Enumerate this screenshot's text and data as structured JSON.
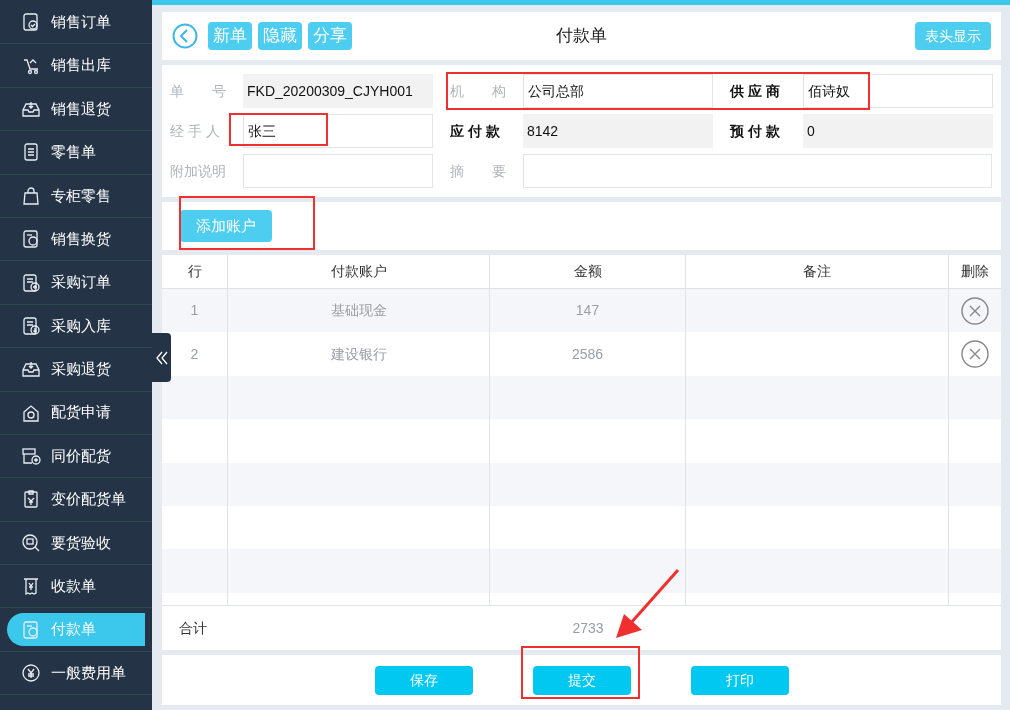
{
  "sidebar": {
    "items": [
      {
        "label": "销售订单",
        "selected": false
      },
      {
        "label": "销售出库",
        "selected": false
      },
      {
        "label": "销售退货",
        "selected": false
      },
      {
        "label": "零售单",
        "selected": false
      },
      {
        "label": "专柜零售",
        "selected": false
      },
      {
        "label": "销售换货",
        "selected": false
      },
      {
        "label": "采购订单",
        "selected": false
      },
      {
        "label": "采购入库",
        "selected": false
      },
      {
        "label": "采购退货",
        "selected": false
      },
      {
        "label": "配货申请",
        "selected": false
      },
      {
        "label": "同价配货",
        "selected": false
      },
      {
        "label": "变价配货单",
        "selected": false
      },
      {
        "label": "要货验收",
        "selected": false
      },
      {
        "label": "收款单",
        "selected": false
      },
      {
        "label": "付款单",
        "selected": true
      },
      {
        "label": "一般费用单",
        "selected": false
      }
    ]
  },
  "toolbar": {
    "buttons": [
      "新单",
      "隐藏",
      "分享"
    ],
    "title": "付款单",
    "right_button": "表头显示"
  },
  "form": {
    "rows": [
      [
        {
          "label": "单　　号",
          "value": "FKD_20200309_CJYH001",
          "emphasis": false,
          "readonly": true
        },
        {
          "label": "机　　构",
          "value": "公司总部",
          "emphasis": false,
          "readonly": false
        },
        {
          "label": "供 应 商",
          "value": "佰诗奴",
          "emphasis": true,
          "readonly": false
        }
      ],
      [
        {
          "label": "经 手 人",
          "value": "张三",
          "emphasis": false,
          "readonly": false
        },
        {
          "label": "应 付 款",
          "value": "8142",
          "emphasis": true,
          "readonly": true
        },
        {
          "label": "预 付 款",
          "value": "0",
          "emphasis": true,
          "readonly": true
        }
      ],
      [
        {
          "label": "附加说明",
          "emphasis": false,
          "readonly": false
        },
        {
          "label": "摘　　要",
          "emphasis": false,
          "readonly": false
        }
      ]
    ]
  },
  "add_button": "添加账户",
  "table": {
    "columns": [
      "行",
      "付款账户",
      "金额",
      "备注",
      "删除"
    ],
    "rows": [
      {
        "cells": [
          "1",
          "基础现金",
          "147"
        ]
      },
      {
        "cells": [
          "2",
          "建设银行",
          "2586"
        ]
      }
    ],
    "total_label": "合计",
    "total_value": "2733"
  },
  "footer_buttons": [
    "保存",
    "提交",
    "打印"
  ]
}
